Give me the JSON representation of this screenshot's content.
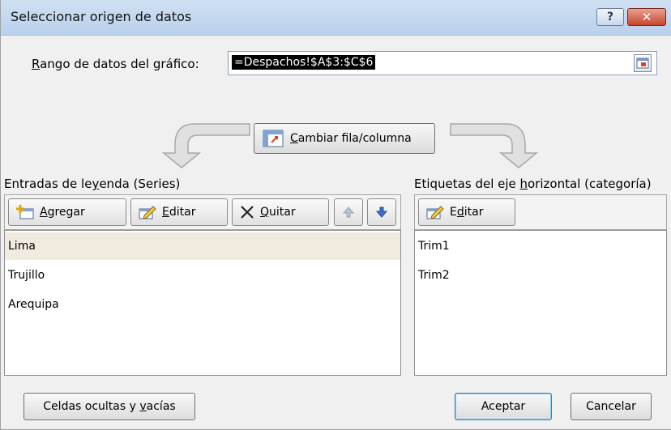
{
  "window": {
    "title": "Seleccionar origen de datos"
  },
  "titlebar": {
    "help_label": "?",
    "close_label": "✕"
  },
  "range": {
    "label_prefix": "R",
    "label_rest": "ango de datos del gráfico:",
    "value": "=Despachos!$A$3:$C$6"
  },
  "switch": {
    "label_prefix": "C",
    "label_rest": "ambiar fila/columna"
  },
  "legend": {
    "title_prefix": "Entradas de le",
    "title_u": "y",
    "title_rest": "enda (Series)",
    "add": {
      "u": "A",
      "rest": "gregar"
    },
    "edit": {
      "u": "E",
      "rest": "ditar"
    },
    "remove": {
      "u": "Q",
      "rest": "uitar"
    },
    "items": [
      "Lima",
      "Trujillo",
      "Arequipa"
    ],
    "selected_index": 0
  },
  "axis": {
    "title_prefix": "Etiquetas del eje ",
    "title_u": "h",
    "title_rest": "orizontal (categoría)",
    "edit": {
      "pre": "E",
      "u": "d",
      "rest": "itar"
    },
    "items": [
      "Trim1",
      "Trim2"
    ]
  },
  "footer": {
    "hidden_cells": {
      "pre": "Celdas ocultas y ",
      "u": "v",
      "rest": "acías"
    },
    "ok_label": "Aceptar",
    "cancel_label": "Cancelar"
  },
  "colors": {
    "titlebar": "#c4d8f0",
    "selected_row": "#f1ebdf",
    "close_button": "#c8452c"
  }
}
